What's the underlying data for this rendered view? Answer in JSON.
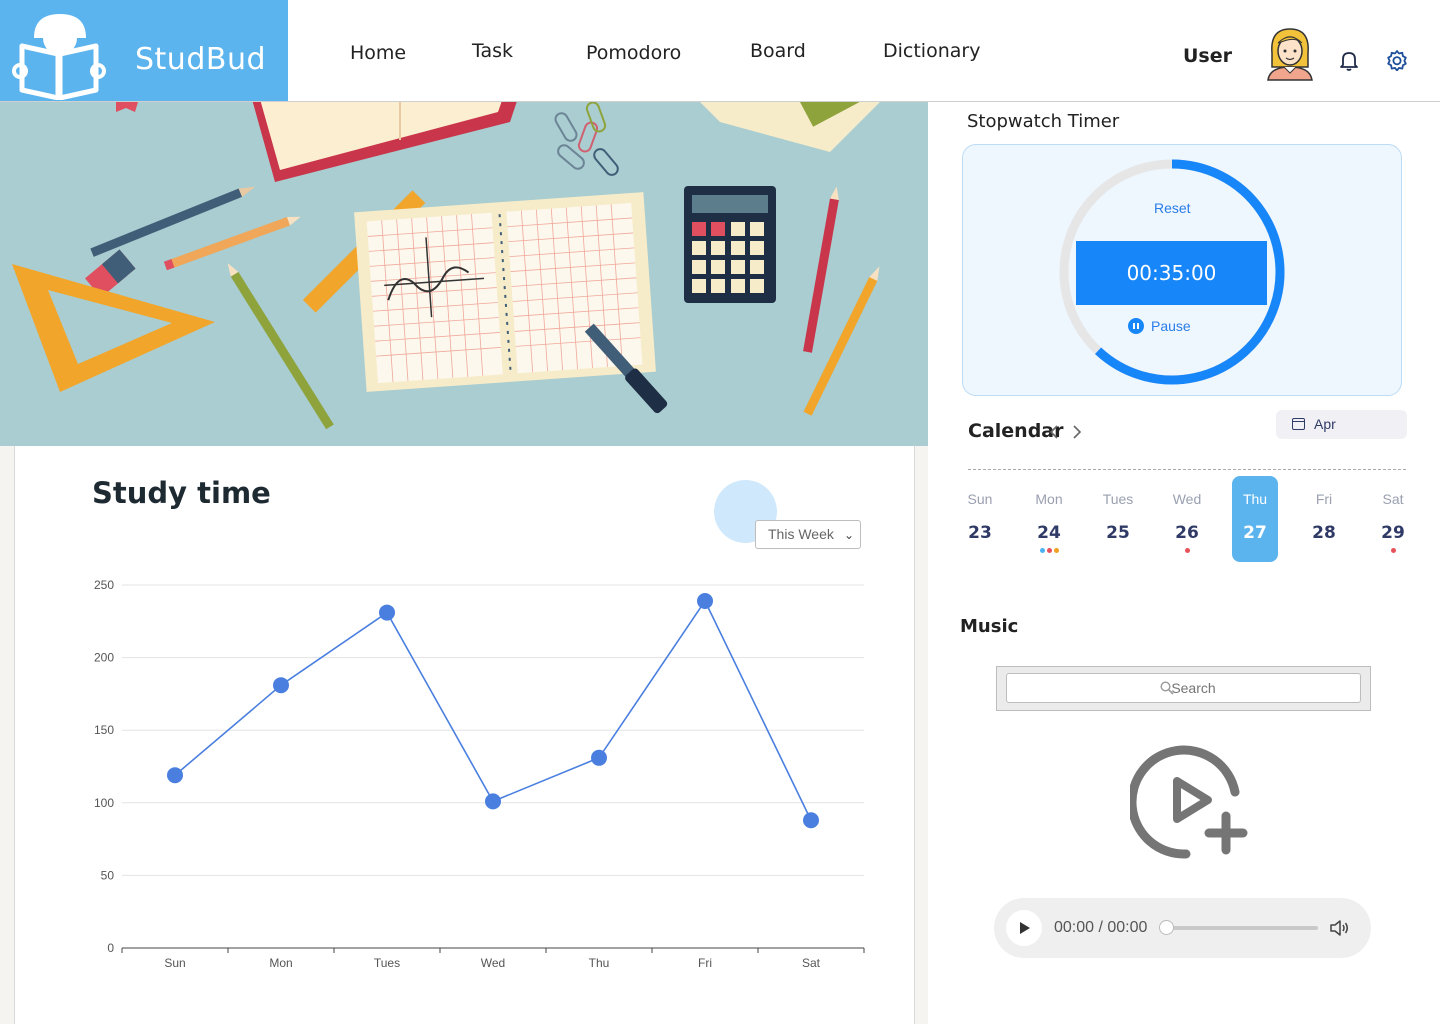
{
  "brand": {
    "name": "StudBud",
    "logo_icon": "reading-book-icon"
  },
  "nav": {
    "items": [
      {
        "label": "Home"
      },
      {
        "label": "Task"
      },
      {
        "label": "Pomodoro"
      },
      {
        "label": "Board"
      },
      {
        "label": "Dictionary"
      }
    ]
  },
  "user": {
    "label": "User",
    "avatar_icon": "user-avatar-icon",
    "notification_icon": "bell-icon",
    "settings_icon": "gear-icon"
  },
  "hero": {
    "image": "study-desk-illustration"
  },
  "study_time": {
    "title": "Study time",
    "range_select": {
      "value": "This Week",
      "options": [
        "This Week"
      ]
    }
  },
  "chart_data": {
    "type": "line",
    "categories": [
      "Sun",
      "Mon",
      "Tues",
      "Wed",
      "Thu",
      "Fri",
      "Sat"
    ],
    "series": [
      {
        "values": [
          119,
          181,
          231,
          101,
          131,
          239,
          88
        ]
      }
    ],
    "ylim": [
      0,
      250
    ],
    "yticks": [
      0,
      50,
      100,
      150,
      200,
      250
    ],
    "grid": true,
    "color": "#4a7fe0"
  },
  "stopwatch": {
    "title": "Stopwatch Timer",
    "reset_label": "Reset",
    "time": "00:35:00",
    "pause_label": "Pause",
    "progress": 0.62,
    "accent": "#1786f9"
  },
  "calendar": {
    "title": "Calendar",
    "prev_icon": "chevron-left-icon",
    "next_icon": "chevron-right-icon",
    "month": "Apr",
    "days": [
      {
        "name": "Sun",
        "num": "23",
        "dots": []
      },
      {
        "name": "Mon",
        "num": "24",
        "dots": [
          "#4ab3f4",
          "#e8525a",
          "#f0a020"
        ]
      },
      {
        "name": "Tues",
        "num": "25",
        "dots": []
      },
      {
        "name": "Wed",
        "num": "26",
        "dots": [
          "#e8525a"
        ]
      },
      {
        "name": "Thu",
        "num": "27",
        "dots": [],
        "active": true
      },
      {
        "name": "Fri",
        "num": "28",
        "dots": []
      },
      {
        "name": "Sat",
        "num": "29",
        "dots": [
          "#e8525a"
        ]
      }
    ]
  },
  "music": {
    "title": "Music",
    "search_placeholder": "Search",
    "add_icon": "add-media-icon",
    "player": {
      "time": "00:00 / 00:00",
      "progress": 0
    }
  }
}
